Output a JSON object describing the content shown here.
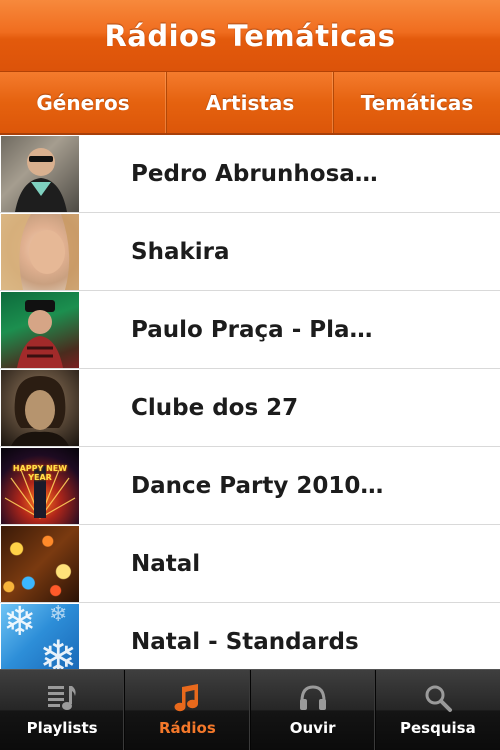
{
  "header": {
    "title": "Rádios Temáticas"
  },
  "segments": [
    {
      "label": "Géneros"
    },
    {
      "label": "Artistas"
    },
    {
      "label": "Temáticas"
    }
  ],
  "list": {
    "items": [
      {
        "label": "Pedro Abrunhosa…",
        "thumbnail": "person-portrait"
      },
      {
        "label": "Shakira",
        "thumbnail": "person-portrait"
      },
      {
        "label": "Paulo Praça - Pla…",
        "thumbnail": "person-portrait"
      },
      {
        "label": "Clube dos 27",
        "thumbnail": "person-portrait"
      },
      {
        "label": "Dance Party 2010…",
        "thumbnail": "new-year-fireworks"
      },
      {
        "label": "Natal",
        "thumbnail": "christmas-lights"
      },
      {
        "label": "Natal - Standards",
        "thumbnail": "snowflakes"
      }
    ]
  },
  "thumbnail_text": {
    "dance_party": "HAPPY NEW YEAR"
  },
  "tabbar": {
    "items": [
      {
        "label": "Playlists",
        "icon": "playlist-icon",
        "active": false
      },
      {
        "label": "Rádios",
        "icon": "music-note-icon",
        "active": true
      },
      {
        "label": "Ouvir",
        "icon": "headphones-icon",
        "active": false
      },
      {
        "label": "Pesquisa",
        "icon": "search-icon",
        "active": false
      }
    ]
  },
  "colors": {
    "accent": "#f06d1f",
    "accent_dark": "#dc530a",
    "tab_active": "#f4782a",
    "tab_inactive": "#ffffff",
    "list_text": "#1c1c1c",
    "tabbar_bg": "#1a1a1a"
  }
}
